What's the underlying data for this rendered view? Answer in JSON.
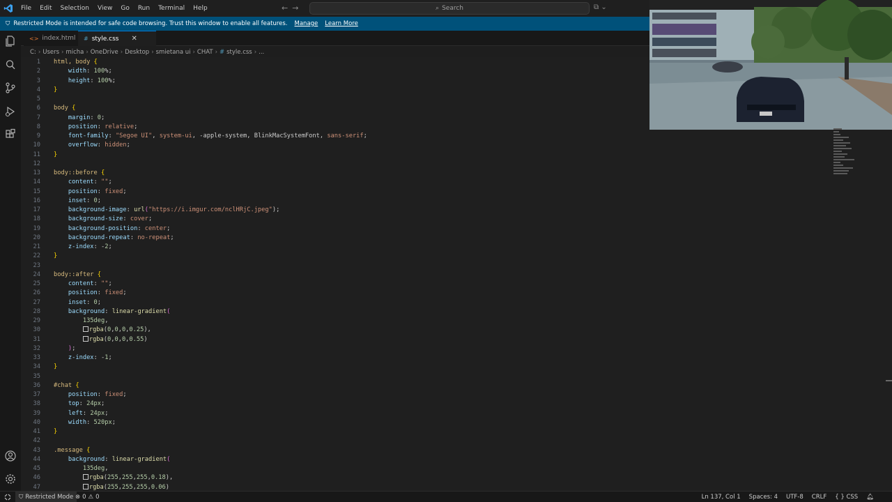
{
  "menu": [
    "File",
    "Edit",
    "Selection",
    "View",
    "Go",
    "Run",
    "Terminal",
    "Help"
  ],
  "search": {
    "placeholder": "Search"
  },
  "banner": {
    "message": "Restricted Mode is intended for safe code browsing. Trust this window to enable all features.",
    "manage": "Manage",
    "learn_more": "Learn More"
  },
  "tabs": [
    {
      "label": "index.html",
      "icon": "html-file-icon"
    },
    {
      "label": "style.css",
      "icon": "css-file-icon"
    }
  ],
  "breadcrumb": [
    "C:",
    "Users",
    "micha",
    "OneDrive",
    "Desktop",
    "smietana ui",
    "CHAT",
    "style.css",
    "..."
  ],
  "editor": {
    "line_numbers": [
      "1",
      "2",
      "3",
      "4",
      "5",
      "6",
      "7",
      "8",
      "9",
      "10",
      "11",
      "12",
      "13",
      "14",
      "15",
      "16",
      "17",
      "18",
      "19",
      "20",
      "21",
      "22",
      "23",
      "24",
      "25",
      "26",
      "27",
      "28",
      "29",
      "30",
      "31",
      "32",
      "33",
      "34",
      "35",
      "36",
      "37",
      "38",
      "39",
      "40",
      "41",
      "42",
      "43",
      "44",
      "45",
      "46",
      "47"
    ],
    "lines": [
      "html, body {",
      "    width: 100%;",
      "    height: 100%;",
      "}",
      "",
      "body {",
      "    margin: 0;",
      "    position: relative;",
      "    font-family: \"Segoe UI\", system-ui, -apple-system, BlinkMacSystemFont, sans-serif;",
      "    overflow: hidden;",
      "}",
      "",
      "body::before {",
      "    content: \"\";",
      "    position: fixed;",
      "    inset: 0;",
      "    background-image: url(\"https://i.imgur.com/nclHRjC.jpeg\");",
      "    background-size: cover;",
      "    background-position: center;",
      "    background-repeat: no-repeat;",
      "    z-index: -2;",
      "}",
      "",
      "body::after {",
      "    content: \"\";",
      "    position: fixed;",
      "    inset: 0;",
      "    background: linear-gradient(",
      "        135deg,",
      "        rgba(0,0,0,0.25),",
      "        rgba(0,0,0,0.55)",
      "    );",
      "    z-index: -1;",
      "}",
      "",
      "#chat {",
      "    position: fixed;",
      "    top: 24px;",
      "    left: 24px;",
      "    width: 520px;",
      "}",
      "",
      ".message {",
      "    background: linear-gradient(",
      "        135deg,",
      "        rgba(255,255,255,0.18),",
      "        rgba(255,255,255,0.06)"
    ]
  },
  "status": {
    "restricted": "Restricted Mode",
    "errors": "0",
    "warnings": "0",
    "position": "Ln 137, Col 1",
    "spaces": "Spaces: 4",
    "encoding": "UTF-8",
    "eol": "CRLF",
    "language": "CSS"
  },
  "colors": {
    "accent": "#0078d4",
    "banner": "#00517a"
  }
}
